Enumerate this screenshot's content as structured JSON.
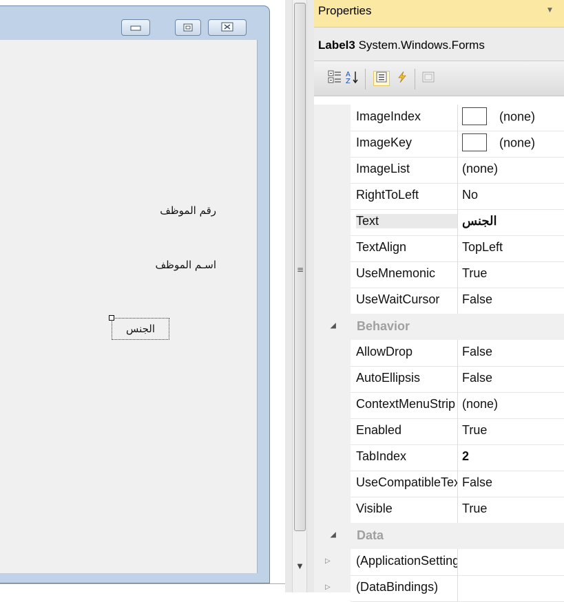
{
  "designer": {
    "labels": [
      "رقم الموظف",
      "اسـم الموظف",
      "الجنس"
    ]
  },
  "properties": {
    "title": "Properties",
    "object_name": "Label3",
    "object_type": "System.Windows.Forms",
    "rows": [
      {
        "name": "ImageIndex",
        "value": "(none)",
        "swatch": true
      },
      {
        "name": "ImageKey",
        "value": "(none)",
        "swatch": true
      },
      {
        "name": "ImageList",
        "value": "(none)"
      },
      {
        "name": "RightToLeft",
        "value": "No"
      },
      {
        "name": "Text",
        "value": "الجنس",
        "bold": true
      },
      {
        "name": "TextAlign",
        "value": "TopLeft"
      },
      {
        "name": "UseMnemonic",
        "value": "True"
      },
      {
        "name": "UseWaitCursor",
        "value": "False"
      }
    ],
    "category_behavior": "Behavior",
    "behavior_rows": [
      {
        "name": "AllowDrop",
        "value": "False"
      },
      {
        "name": "AutoEllipsis",
        "value": "False"
      },
      {
        "name": "ContextMenuStrip",
        "value": "(none)"
      },
      {
        "name": "Enabled",
        "value": "True"
      },
      {
        "name": "TabIndex",
        "value": "2",
        "bold": true
      },
      {
        "name": "UseCompatibleTextRendering",
        "value": "False"
      },
      {
        "name": "Visible",
        "value": "True"
      }
    ],
    "category_data": "Data",
    "data_rows": [
      {
        "name": "(ApplicationSettings)",
        "value": ""
      },
      {
        "name": "(DataBindings)",
        "value": ""
      }
    ]
  },
  "icons": {
    "toolbar": [
      "categorized-icon",
      "alphabetical-icon",
      "properties-icon",
      "events-icon",
      "property-pages-icon"
    ],
    "caption": [
      "minimize-icon",
      "maximize-icon",
      "close-icon"
    ]
  }
}
